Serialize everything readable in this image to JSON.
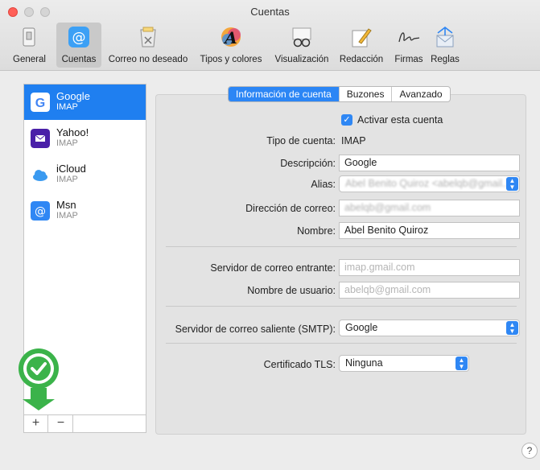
{
  "window": {
    "title": "Cuentas"
  },
  "toolbar": {
    "items": [
      {
        "label": "General"
      },
      {
        "label": "Cuentas"
      },
      {
        "label": "Correo no deseado"
      },
      {
        "label": "Tipos y colores"
      },
      {
        "label": "Visualización"
      },
      {
        "label": "Redacción"
      },
      {
        "label": "Firmas"
      },
      {
        "label": "Reglas"
      }
    ]
  },
  "accounts": [
    {
      "name": "Google",
      "type": "IMAP",
      "icon": "google-icon",
      "color": "#ffffff"
    },
    {
      "name": "Yahoo!",
      "type": "IMAP",
      "icon": "yahoo-icon",
      "color": "#4a1fa8"
    },
    {
      "name": "iCloud",
      "type": "IMAP",
      "icon": "icloud-icon",
      "color": "#3a9af0"
    },
    {
      "name": "Msn",
      "type": "IMAP",
      "icon": "msn-icon",
      "color": "#2f87f4"
    }
  ],
  "list_buttons": {
    "add": "+",
    "remove": "−"
  },
  "tabs": [
    {
      "label": "Información de cuenta",
      "active": true
    },
    {
      "label": "Buzones",
      "active": false
    },
    {
      "label": "Avanzado",
      "active": false
    }
  ],
  "form": {
    "enable_label": "Activar esta cuenta",
    "enable_checked": true,
    "account_type_label": "Tipo de cuenta:",
    "account_type_value": "IMAP",
    "description_label": "Descripción:",
    "description_value": "Google",
    "alias_label": "Alias:",
    "alias_value": "Abel Benito Quiroz <abelqb@gmail...",
    "email_label": "Dirección de correo:",
    "email_value": "abelqb@gmail.com",
    "name_label": "Nombre:",
    "name_value": "Abel Benito Quiroz",
    "incoming_label": "Servidor de correo entrante:",
    "incoming_placeholder": "imap.gmail.com",
    "username_label": "Nombre de usuario:",
    "username_placeholder": "abelqb@gmail.com",
    "smtp_label": "Servidor de correo saliente (SMTP):",
    "smtp_value": "Google",
    "tls_label": "Certificado TLS:",
    "tls_value": "Ninguna"
  },
  "help": "?",
  "colors": {
    "accent": "#2f87f4",
    "selection": "#1f7ff0",
    "badge": "#3bb34a"
  }
}
